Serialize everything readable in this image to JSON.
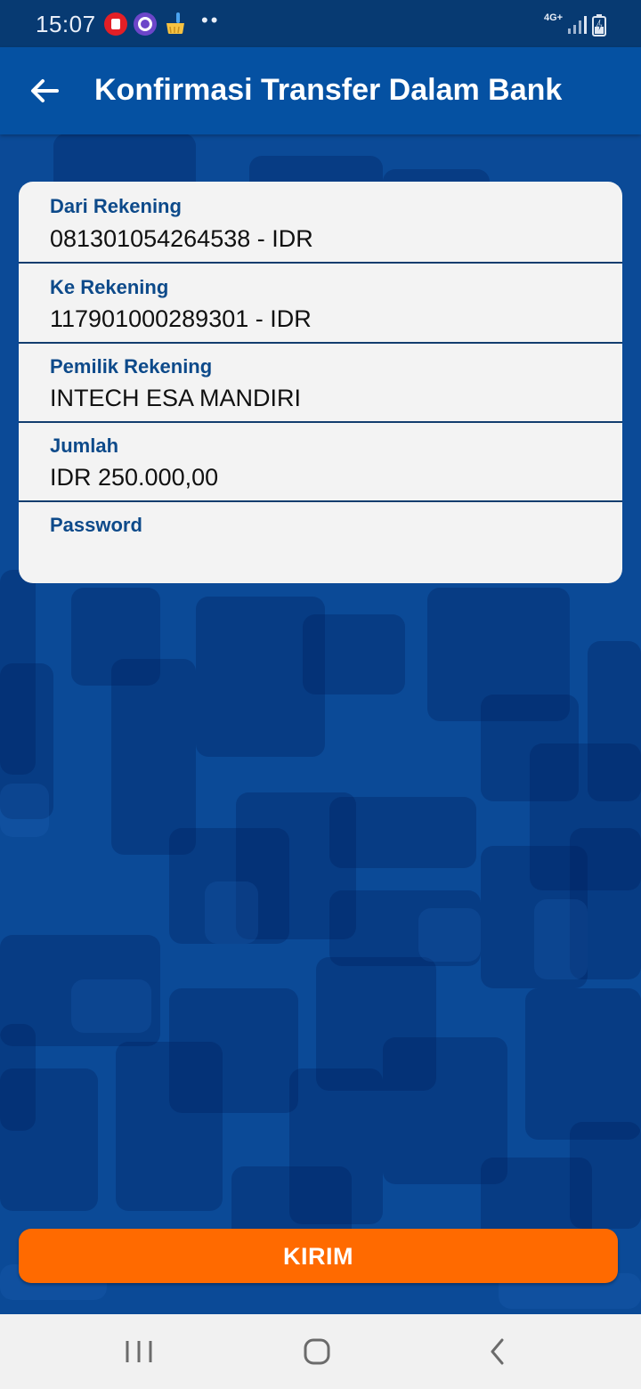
{
  "status_bar": {
    "time": "15:07",
    "dots": "••",
    "network": "4G+",
    "icons": [
      "trash-icon",
      "circle-app-icon",
      "broom-icon",
      "signal-icon",
      "battery-charging-icon"
    ]
  },
  "app_bar": {
    "title": "Konfirmasi Transfer Dalam Bank",
    "back_icon": "arrow-left-icon"
  },
  "confirmation": {
    "from_account": {
      "label": "Dari Rekening",
      "value": "081301054264538 - IDR"
    },
    "to_account": {
      "label": "Ke Rekening",
      "value": "117901000289301 - IDR"
    },
    "account_owner": {
      "label": "Pemilik Rekening",
      "value": "INTECH ESA MANDIRI"
    },
    "amount": {
      "label": "Jumlah",
      "value": "IDR 250.000,00"
    },
    "password": {
      "label": "Password",
      "value": "",
      "placeholder": ""
    }
  },
  "actions": {
    "submit_label": "KIRIM",
    "submit_color": "#ff6a00"
  },
  "nav_bar": {
    "icons": [
      "recent-apps-icon",
      "home-icon",
      "back-icon"
    ]
  },
  "colors": {
    "primary": "#0551a2",
    "status_bar": "#073a72",
    "label": "#0d4a8a",
    "card": "#f3f3f3",
    "accent": "#ff6a00"
  }
}
